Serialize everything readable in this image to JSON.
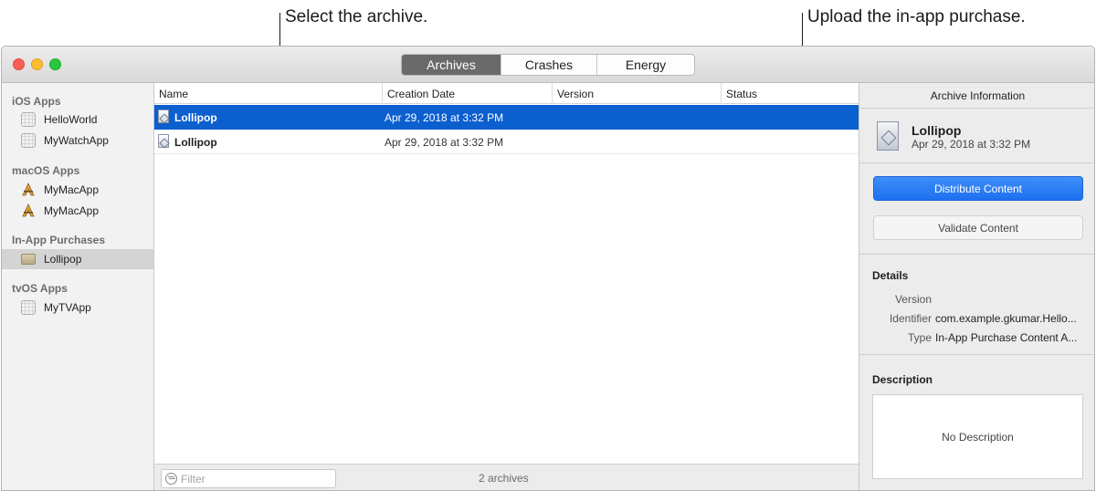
{
  "callouts": {
    "select_archive": "Select the archive.",
    "upload": "Upload the in-app purchase."
  },
  "tabs": [
    {
      "label": "Archives",
      "active": true
    },
    {
      "label": "Crashes",
      "active": false
    },
    {
      "label": "Energy",
      "active": false
    }
  ],
  "sidebar": {
    "sections": [
      {
        "title": "iOS Apps",
        "items": [
          {
            "label": "HelloWorld",
            "icon": "ios-app-icon"
          },
          {
            "label": "MyWatchApp",
            "icon": "ios-app-icon"
          }
        ]
      },
      {
        "title": "macOS Apps",
        "items": [
          {
            "label": "MyMacApp",
            "icon": "macos-app-icon"
          },
          {
            "label": "MyMacApp",
            "icon": "macos-app-icon"
          }
        ]
      },
      {
        "title": "In-App Purchases",
        "items": [
          {
            "label": "Lollipop",
            "icon": "package-icon",
            "selected": true
          }
        ]
      },
      {
        "title": "tvOS Apps",
        "items": [
          {
            "label": "MyTVApp",
            "icon": "ios-app-icon"
          }
        ]
      }
    ]
  },
  "table": {
    "columns": [
      "Name",
      "Creation Date",
      "Version",
      "Status"
    ],
    "rows": [
      {
        "name": "Lollipop",
        "date": "Apr 29, 2018 at 3:32 PM",
        "version": "",
        "status": "",
        "selected": true
      },
      {
        "name": "Lollipop",
        "date": "Apr 29, 2018 at 3:32 PM",
        "version": "",
        "status": "",
        "selected": false
      }
    ]
  },
  "footer": {
    "filter_placeholder": "Filter",
    "count": "2 archives"
  },
  "inspector": {
    "title": "Archive Information",
    "name": "Lollipop",
    "date": "Apr 29, 2018 at 3:32 PM",
    "distribute_label": "Distribute Content",
    "validate_label": "Validate Content",
    "details_title": "Details",
    "details": [
      {
        "label": "Version",
        "value": ""
      },
      {
        "label": "Identifier",
        "value": "com.example.gkumar.Hello..."
      },
      {
        "label": "Type",
        "value": "In-App Purchase Content A..."
      }
    ],
    "description_title": "Description",
    "description": "No Description"
  },
  "colors": {
    "selection": "#0b5fcf",
    "primary_button": "#1e6ff0",
    "active_tab": "#6a6a6a"
  }
}
